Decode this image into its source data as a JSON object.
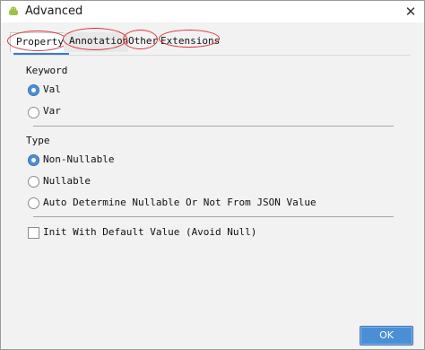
{
  "window": {
    "title": "Advanced",
    "close_glyph": "✕"
  },
  "tabs": [
    {
      "label": "Property",
      "active": true
    },
    {
      "label": "Annotation",
      "active": false
    },
    {
      "label": "Other",
      "active": false
    },
    {
      "label": "Extensions",
      "active": false
    }
  ],
  "keyword": {
    "heading": "Keyword",
    "options": [
      {
        "label": "Val",
        "selected": true
      },
      {
        "label": "Var",
        "selected": false
      }
    ]
  },
  "type": {
    "heading": "Type",
    "options": [
      {
        "label": "Non-Nullable",
        "selected": true
      },
      {
        "label": "Nullable",
        "selected": false
      },
      {
        "label": "Auto Determine Nullable Or Not From JSON Value",
        "selected": false
      }
    ]
  },
  "init_default": {
    "label": "Init With Default Value (Avoid Null)",
    "checked": false
  },
  "buttons": {
    "ok_label": "OK"
  },
  "colors": {
    "accent": "#4a8fd6",
    "annotation_ring": "#d9343a"
  }
}
